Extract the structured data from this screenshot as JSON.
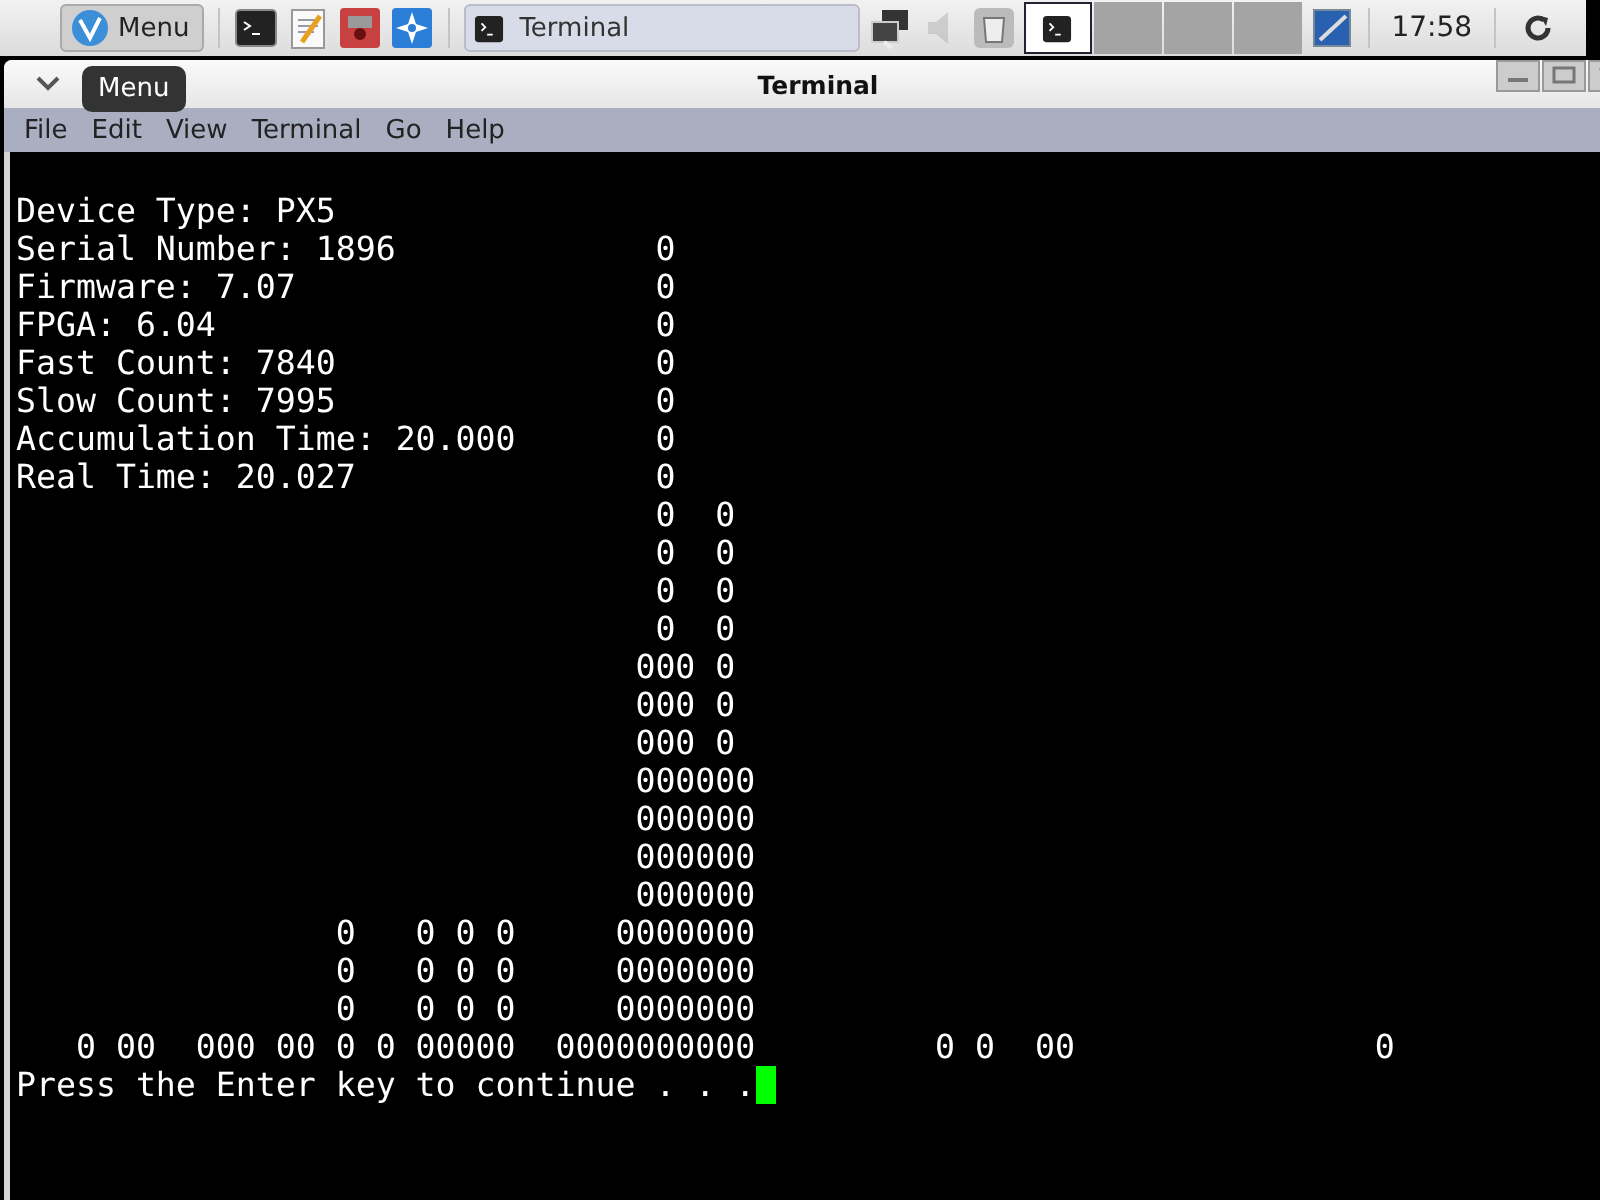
{
  "panel": {
    "menu_button": "Menu",
    "task": {
      "label": "Terminal",
      "selected": false
    },
    "workspaces": [
      {
        "selected": true
      },
      {
        "selected": false
      },
      {
        "selected": false
      },
      {
        "selected": false
      }
    ],
    "clock": "17:58"
  },
  "tooltip": "Menu",
  "window": {
    "title": "Terminal"
  },
  "menu": [
    "File",
    "Edit",
    "View",
    "Terminal",
    "Go",
    "Help"
  ],
  "terminal": {
    "lines": [
      "Device Type: PX5",
      "Serial Number: 1896             0",
      "Firmware: 7.07                  0",
      "FPGA: 6.04                      0",
      "Fast Count: 7840                0",
      "Slow Count: 7995                0",
      "Accumulation Time: 20.000       0",
      "Real Time: 20.027               0",
      "                                0  0",
      "                                0  0",
      "                                0  0",
      "                                0  0",
      "                               000 0",
      "                               000 0",
      "                               000 0",
      "                               000000",
      "                               000000",
      "                               000000",
      "                               000000",
      "                0   0 0 0     0000000",
      "                0   0 0 0     0000000",
      "                0   0 0 0     0000000",
      "   0 00  000 00 0 0 00000  0000000000         0 0  00               0"
    ],
    "prompt": "Press the Enter key to continue . . ."
  }
}
